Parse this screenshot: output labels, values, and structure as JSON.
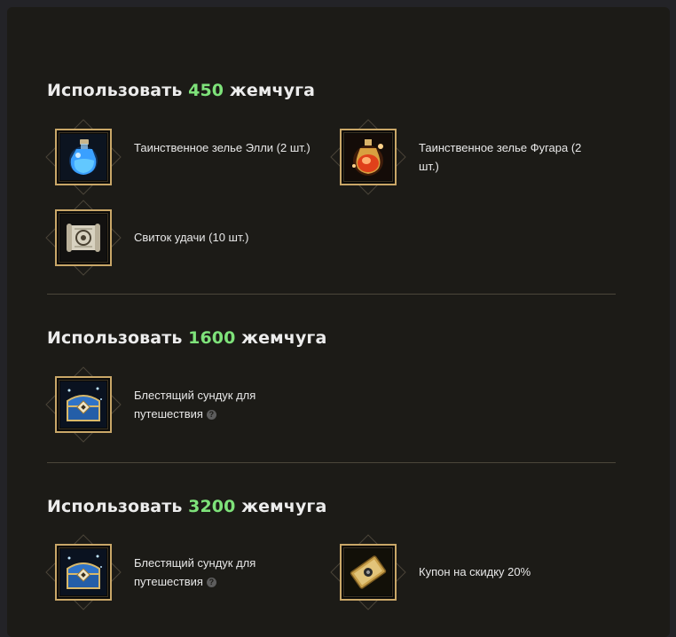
{
  "tiers": [
    {
      "prefix": "Использовать",
      "amount": "450",
      "suffix": "жемчуга",
      "rewards": [
        {
          "name": "Таинственное зелье Элли (2 шт.)",
          "icon": "blue-potion-icon",
          "has_help": false
        },
        {
          "name": "Таинственное зелье Фугара (2 шт.)",
          "icon": "red-potion-icon",
          "has_help": false
        },
        {
          "name": "Свиток удачи (10 шт.)",
          "icon": "scroll-icon",
          "has_help": false
        }
      ]
    },
    {
      "prefix": "Использовать",
      "amount": "1600",
      "suffix": "жемчуга",
      "rewards": [
        {
          "name": "Блестящий сундук для путешествия",
          "icon": "treasure-chest-icon",
          "has_help": true
        }
      ]
    },
    {
      "prefix": "Использовать",
      "amount": "3200",
      "suffix": "жемчуга",
      "rewards": [
        {
          "name": "Блестящий сундук для путешествия",
          "icon": "treasure-chest-icon",
          "has_help": true
        },
        {
          "name": "Купон на скидку 20%",
          "icon": "coupon-icon",
          "has_help": false
        }
      ]
    }
  ],
  "help_glyph": "?",
  "colors": {
    "background": "#1c1b17",
    "accent_amount": "#7ee27a",
    "frame_gold": "#c9a768",
    "text": "#e8e8e8"
  }
}
